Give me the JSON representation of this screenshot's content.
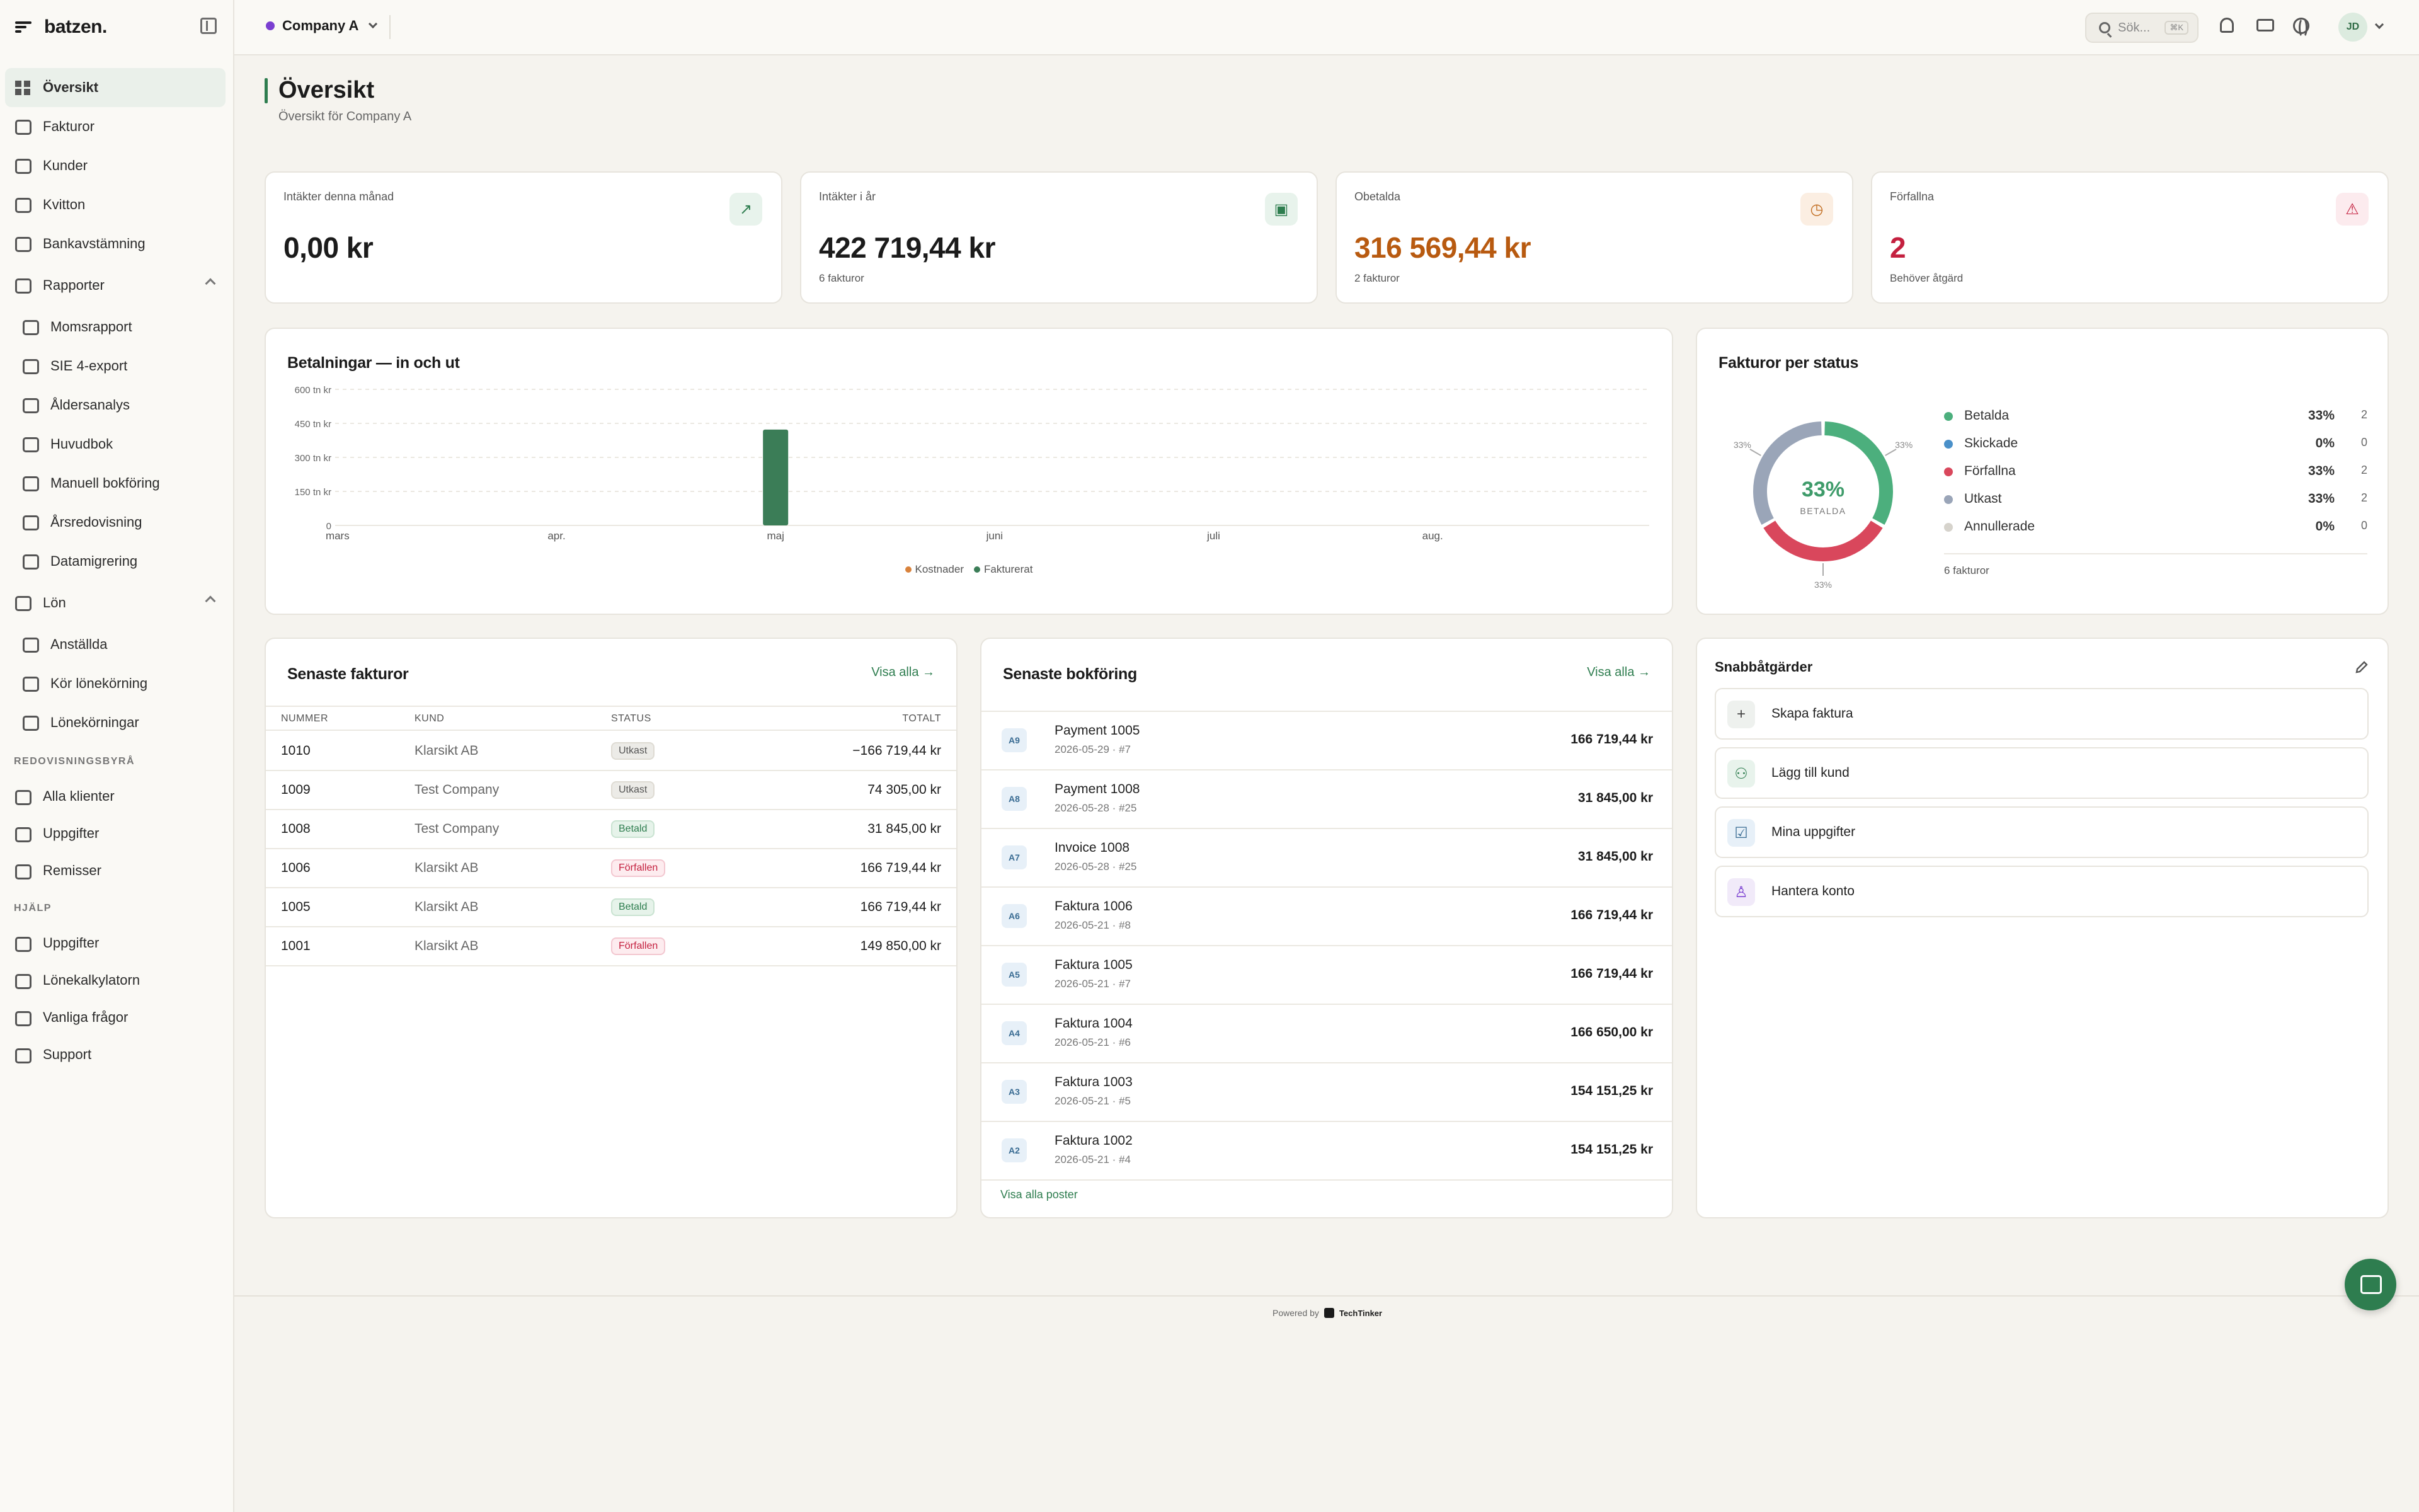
{
  "app": {
    "brand": "batzen."
  },
  "topbar": {
    "company": "Company A",
    "search_placeholder": "Sök...",
    "search_shortcut": "⌘K",
    "avatar_initials": "JD"
  },
  "sidebar": {
    "items": [
      {
        "label": "Översikt",
        "icon": "grid-icon"
      },
      {
        "label": "Fakturor",
        "icon": "document-icon"
      },
      {
        "label": "Kunder",
        "icon": "users-icon"
      },
      {
        "label": "Kvitton",
        "icon": "scan-icon"
      },
      {
        "label": "Bankavstämning",
        "icon": "arrows-icon"
      },
      {
        "label": "Rapporter",
        "icon": "bar-chart-icon"
      },
      {
        "label": "Momsrapport",
        "icon": "receipt-icon"
      },
      {
        "label": "SIE 4-export",
        "icon": "export-icon"
      },
      {
        "label": "Åldersanalys",
        "icon": "warning-icon"
      },
      {
        "label": "Huvudbok",
        "icon": "book-icon"
      },
      {
        "label": "Manuell bokföring",
        "icon": "pen-icon"
      },
      {
        "label": "Årsredovisning",
        "icon": "report-icon"
      },
      {
        "label": "Datamigrering",
        "icon": "database-icon"
      },
      {
        "label": "Lön",
        "icon": "user-icon"
      },
      {
        "label": "Anställda",
        "icon": "user-icon"
      },
      {
        "label": "Kör lönekörning",
        "icon": "play-icon"
      },
      {
        "label": "Lönekörningar",
        "icon": "history-icon"
      },
      {
        "label": "Alla klienter",
        "icon": "briefcase-icon"
      },
      {
        "label": "Uppgifter",
        "icon": "checkbox-icon"
      },
      {
        "label": "Remisser",
        "icon": "route-icon"
      },
      {
        "label": "Uppgifter",
        "icon": "checkbox-icon"
      },
      {
        "label": "Lönekalkylatorn",
        "icon": "calculator-icon"
      },
      {
        "label": "Vanliga frågor",
        "icon": "help-icon"
      },
      {
        "label": "Support",
        "icon": "lifebuoy-icon"
      }
    ],
    "section_agency": "REDOVISNINGSBYRÅ",
    "section_help": "HJÄLP"
  },
  "header": {
    "title": "Översikt",
    "subtitle": "Översikt för Company A"
  },
  "kpis": [
    {
      "label": "Intäkter denna månad",
      "value": "0,00 kr",
      "sub": "",
      "color": "#1b1b1b",
      "icon": "trending-up-icon",
      "icon_char": "↗",
      "icon_bg": "#e8f3ec",
      "icon_fg": "#2e7d4f"
    },
    {
      "label": "Intäkter i år",
      "value": "422 719,44 kr",
      "sub": "6 fakturor",
      "color": "#1b1b1b",
      "icon": "wallet-icon",
      "icon_char": "▣",
      "icon_bg": "#e8f3ec",
      "icon_fg": "#2e7d4f"
    },
    {
      "label": "Obetalda",
      "value": "316 569,44 kr",
      "sub": "2 fakturor",
      "color": "#b85a10",
      "icon": "clock-icon",
      "icon_char": "◷",
      "icon_bg": "#fbeee2",
      "icon_fg": "#c06a1c"
    },
    {
      "label": "Förfallna",
      "value": "2",
      "sub": "Behöver åtgärd",
      "color": "#c4203f",
      "icon": "alert-triangle-icon",
      "icon_char": "⚠",
      "icon_bg": "#fcebee",
      "icon_fg": "#c4203f"
    }
  ],
  "payments_chart": {
    "title": "Betalningar — in och ut",
    "legend_costs": "Kostnader",
    "legend_invoiced": "Fakturerat",
    "costs_color": "#d9823b",
    "invoiced_color": "#3b7d57"
  },
  "chart_data": [
    {
      "type": "bar",
      "title": "Betalningar — in och ut",
      "categories": [
        "mars",
        "apr.",
        "maj",
        "juni",
        "juli",
        "aug."
      ],
      "series": [
        {
          "name": "Kostnader",
          "values": [
            0,
            0,
            0,
            0,
            0,
            0
          ]
        },
        {
          "name": "Fakturerat",
          "values": [
            0,
            0,
            422719.44,
            0,
            0,
            0
          ]
        }
      ],
      "y_ticks": [
        "0",
        "150 tn kr",
        "300 tn kr",
        "450 tn kr",
        "600 tn kr"
      ],
      "ylim": [
        0,
        600000
      ],
      "grid": true,
      "legend": "bottom"
    },
    {
      "type": "pie",
      "title": "Fakturor per status",
      "categories": [
        "Betalda",
        "Skickade",
        "Förfallna",
        "Utkast",
        "Annullerade"
      ],
      "values": [
        2,
        0,
        2,
        2,
        0
      ],
      "percent_labels": [
        "33%",
        "0%",
        "33%",
        "33%",
        "0%"
      ],
      "colors": [
        "#4caf7d",
        "#4a90c9",
        "#d9475c",
        "#9aa5b8",
        "#d6d3cc"
      ],
      "center_value": "33%",
      "center_label": "BETALDA",
      "total_label": "6 fakturor"
    }
  ],
  "status_card": {
    "title": "Fakturor per status"
  },
  "invoices": {
    "title": "Senaste fakturor",
    "view_all": "Visa alla →",
    "headers": [
      "NUMMER",
      "KUND",
      "STATUS",
      "TOTALT"
    ],
    "rows": [
      {
        "number": "1010",
        "customer": "Klarsikt AB",
        "status": "Utkast",
        "kind": "draft",
        "total": "−166 719,44 kr"
      },
      {
        "number": "1009",
        "customer": "Test Company",
        "status": "Utkast",
        "kind": "draft",
        "total": "74 305,00 kr"
      },
      {
        "number": "1008",
        "customer": "Test Company",
        "status": "Betald",
        "kind": "paid",
        "total": "31 845,00 kr"
      },
      {
        "number": "1006",
        "customer": "Klarsikt AB",
        "status": "Förfallen",
        "kind": "overdue",
        "total": "166 719,44 kr"
      },
      {
        "number": "1005",
        "customer": "Klarsikt AB",
        "status": "Betald",
        "kind": "paid",
        "total": "166 719,44 kr"
      },
      {
        "number": "1001",
        "customer": "Klarsikt AB",
        "status": "Förfallen",
        "kind": "overdue",
        "total": "149 850,00 kr"
      }
    ]
  },
  "ledger": {
    "title": "Senaste bokföring",
    "view_all": "Visa alla →",
    "footer": "Visa alla poster",
    "rows": [
      {
        "badge": "A9",
        "title": "Payment 1005",
        "meta": "2026-05-29 · #7",
        "amount": "166 719,44 kr"
      },
      {
        "badge": "A8",
        "title": "Payment 1008",
        "meta": "2026-05-28 · #25",
        "amount": "31 845,00 kr"
      },
      {
        "badge": "A7",
        "title": "Invoice 1008",
        "meta": "2026-05-28 · #25",
        "amount": "31 845,00 kr"
      },
      {
        "badge": "A6",
        "title": "Faktura 1006",
        "meta": "2026-05-21 · #8",
        "amount": "166 719,44 kr"
      },
      {
        "badge": "A5",
        "title": "Faktura 1005",
        "meta": "2026-05-21 · #7",
        "amount": "166 719,44 kr"
      },
      {
        "badge": "A4",
        "title": "Faktura 1004",
        "meta": "2026-05-21 · #6",
        "amount": "166 650,00 kr"
      },
      {
        "badge": "A3",
        "title": "Faktura 1003",
        "meta": "2026-05-21 · #5",
        "amount": "154 151,25 kr"
      },
      {
        "badge": "A2",
        "title": "Faktura 1002",
        "meta": "2026-05-21 · #4",
        "amount": "154 151,25 kr"
      }
    ]
  },
  "quick_actions": {
    "title": "Snabbåtgärder",
    "items": [
      {
        "label": "Skapa faktura",
        "icon": "plus-icon",
        "char": "+",
        "bg": "#eef1ee",
        "fg": "#444"
      },
      {
        "label": "Lägg till kund",
        "icon": "user-plus-icon",
        "char": "⚇",
        "bg": "#e8f3ec",
        "fg": "#2e7d4f"
      },
      {
        "label": "Mina uppgifter",
        "icon": "check-square-icon",
        "char": "☑",
        "bg": "#e7f0f8",
        "fg": "#3a6c93"
      },
      {
        "label": "Hantera konto",
        "icon": "user-icon",
        "char": "♙",
        "bg": "#f1eaf9",
        "fg": "#7a3fd1"
      }
    ]
  },
  "footer": {
    "powered_by": "Powered by",
    "vendor": "TechTinker"
  }
}
